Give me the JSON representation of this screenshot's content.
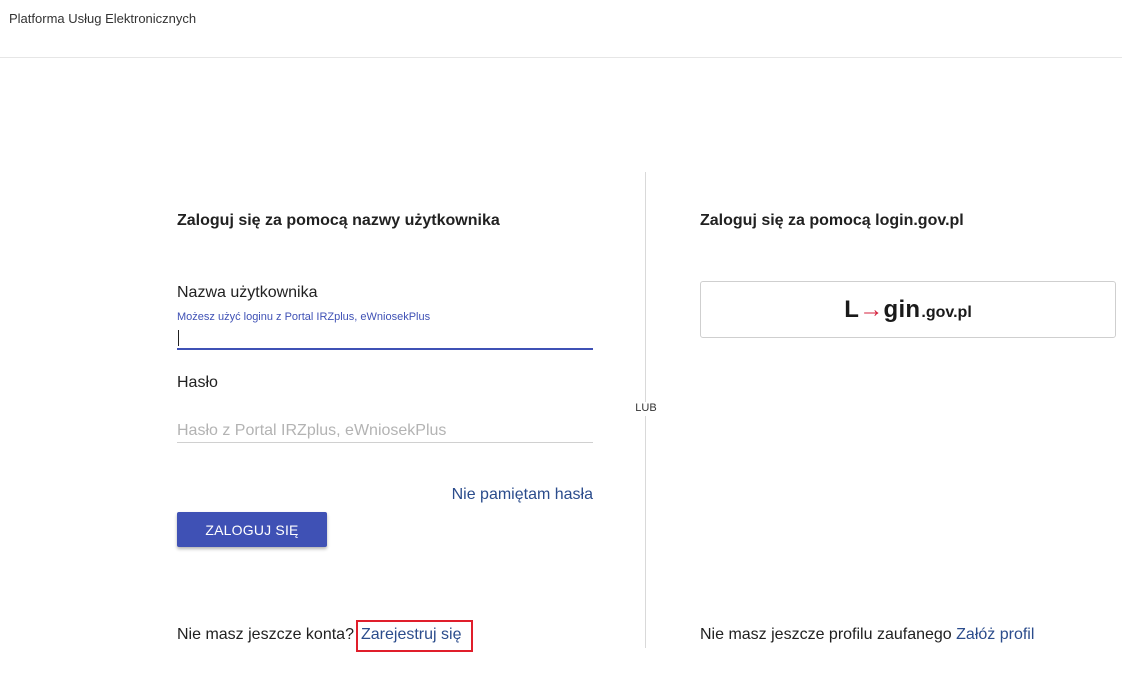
{
  "header": {
    "app_title": "Platforma Usług Elektronicznych"
  },
  "login_form": {
    "title": "Zaloguj się za pomocą nazwy użytkownika",
    "username": {
      "label": "Nazwa użytkownika",
      "hint": "Możesz użyć loginu z Portal IRZplus, eWniosekPlus",
      "value": ""
    },
    "password": {
      "label": "Hasło",
      "placeholder": "Hasło z Portal IRZplus, eWniosekPlus",
      "value": ""
    },
    "forgot_password": "Nie pamiętam hasła",
    "submit_label": "ZALOGUJ SIĘ",
    "no_account_text": "Nie masz jeszcze konta?",
    "register_link": "Zarejestruj się"
  },
  "separator": {
    "label": "LUB"
  },
  "logingov": {
    "title": "Zaloguj się za pomocą login.gov.pl",
    "logo_text_start": "L",
    "logo_arrow": "→",
    "logo_text_end": "gin",
    "logo_suffix": ".gov.pl",
    "no_profile_text": "Nie masz jeszcze profilu zaufanego",
    "create_profile_link": "Załóż profil"
  },
  "colors": {
    "primary": "#3f51b5",
    "link": "#2b4c8c",
    "highlight_border": "#e01e2b",
    "logo_accent": "#d4213d"
  },
  "icons": [
    "login-gov-logo-arrow"
  ]
}
